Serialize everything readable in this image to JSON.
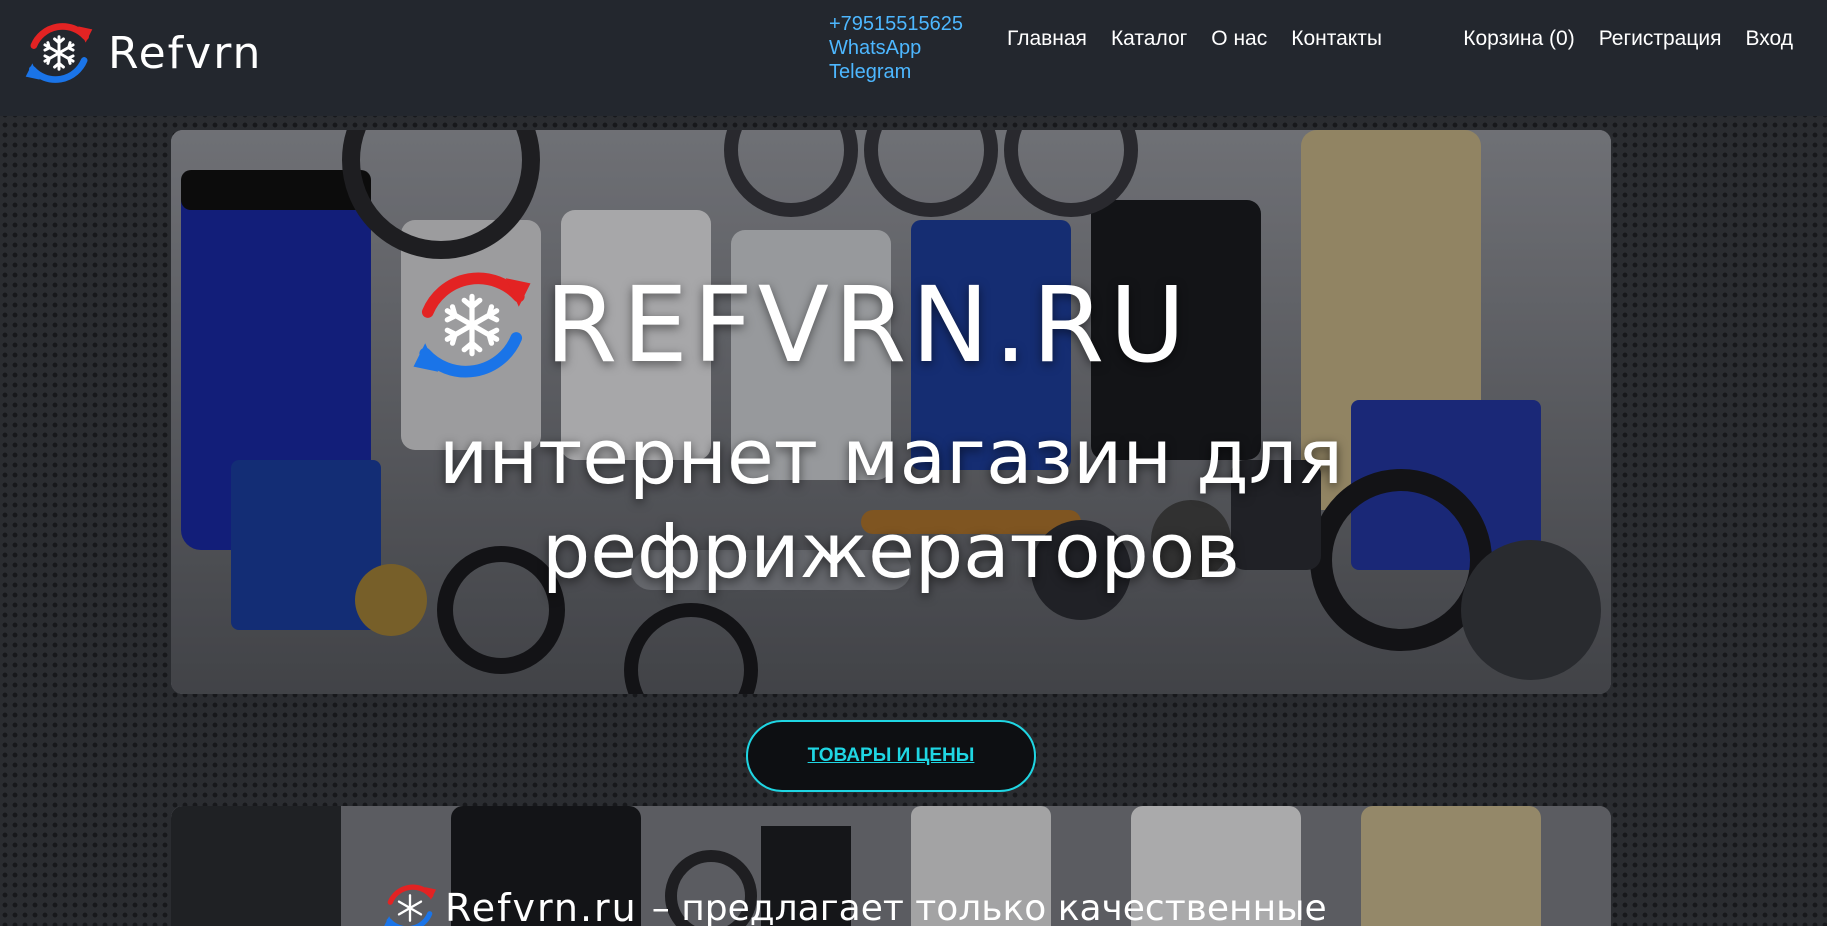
{
  "header": {
    "logo_text": "Refvrn",
    "contacts": {
      "phone": "+79515515625",
      "whatsapp": "WhatsApp",
      "telegram": "Telegram"
    },
    "nav": [
      {
        "label": "Главная"
      },
      {
        "label": "Каталог"
      },
      {
        "label": "О нас"
      },
      {
        "label": "Контакты"
      }
    ],
    "user_nav": {
      "cart": "Корзина (0)",
      "register": "Регистрация",
      "login": "Вход"
    }
  },
  "hero": {
    "brand": "REFVRN.RU",
    "tagline_line1": "интернет магазин для",
    "tagline_line2": "рефрижераторов"
  },
  "cta": {
    "label": "ТОВАРЫ И ЦЕНЫ"
  },
  "section2": {
    "brand": "Refvrn.ru",
    "text": "– предлагает только качественные"
  },
  "colors": {
    "header_bg": "#23272e",
    "link_blue": "#4db7ff",
    "cta_cyan": "#1fd6e3",
    "logo_red": "#e32323",
    "logo_blue": "#1a74e8"
  },
  "icons": {
    "logo": "snowflake-refresh-logo-icon"
  }
}
